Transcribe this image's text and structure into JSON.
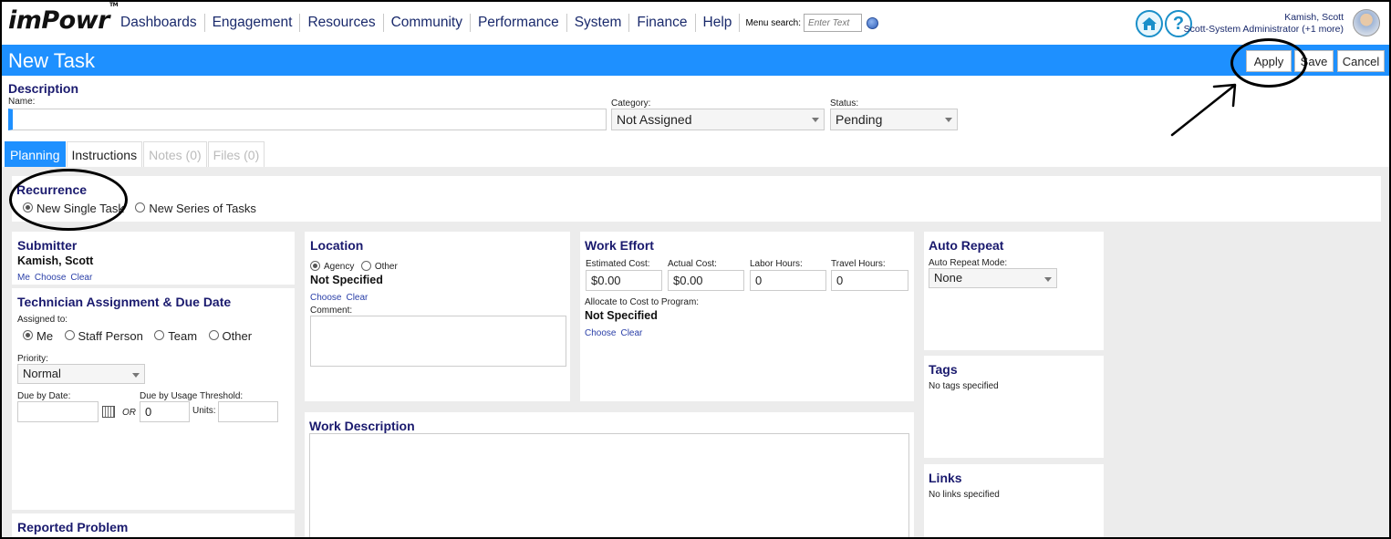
{
  "app": {
    "logo": "imPowr",
    "logo_tm": "TM"
  },
  "nav": {
    "items": [
      "Dashboards",
      "Engagement",
      "Resources",
      "Community",
      "Performance",
      "System",
      "Finance",
      "Help"
    ],
    "menu_search_label": "Menu search:",
    "menu_search_placeholder": "Enter Text"
  },
  "user": {
    "name": "Kamish, Scott",
    "role": "Scott-System Administrator (+1 more)"
  },
  "title_bar": {
    "title": "New Task",
    "apply": "Apply",
    "save": "Save",
    "cancel": "Cancel"
  },
  "description": {
    "title": "Description",
    "name_label": "Name:",
    "name_value": "",
    "category_label": "Category:",
    "category_value": "Not Assigned",
    "status_label": "Status:",
    "status_value": "Pending"
  },
  "tabs": [
    "Planning",
    "Instructions",
    "Notes (0)",
    "Files (0)"
  ],
  "recurrence": {
    "title": "Recurrence",
    "options": [
      "New Single Task",
      "New Series of Tasks"
    ],
    "selected": "New Single Task"
  },
  "submitter": {
    "title": "Submitter",
    "name": "Kamish, Scott",
    "links": [
      "Me",
      "Choose",
      "Clear"
    ]
  },
  "technician": {
    "title": "Technician Assignment & Due Date",
    "assigned_label": "Assigned to:",
    "assigned_options": [
      "Me",
      "Staff Person",
      "Team",
      "Other"
    ],
    "priority_label": "Priority:",
    "priority_value": "Normal",
    "due_date_label": "Due by Date:",
    "or_label": "OR",
    "due_usage_label": "Due by Usage Threshold:",
    "due_usage_value": "0",
    "units_label": "Units:"
  },
  "reported_problem": {
    "title": "Reported Problem"
  },
  "location": {
    "title": "Location",
    "options": [
      "Agency",
      "Other"
    ],
    "value": "Not Specified",
    "links": [
      "Choose",
      "Clear"
    ],
    "comment_label": "Comment:"
  },
  "work_effort": {
    "title": "Work Effort",
    "estimated_cost_label": "Estimated Cost:",
    "estimated_cost": "$0.00",
    "actual_cost_label": "Actual Cost:",
    "actual_cost": "$0.00",
    "labor_hours_label": "Labor Hours:",
    "labor_hours": "0",
    "travel_hours_label": "Travel Hours:",
    "travel_hours": "0",
    "allocate_label": "Allocate to Cost to Program:",
    "allocate_value": "Not Specified",
    "links": [
      "Choose",
      "Clear"
    ]
  },
  "work_description": {
    "title": "Work Description"
  },
  "auto_repeat": {
    "title": "Auto Repeat",
    "mode_label": "Auto Repeat Mode:",
    "mode_value": "None"
  },
  "tags": {
    "title": "Tags",
    "empty": "No tags specified"
  },
  "links_panel": {
    "title": "Links",
    "empty": "No links specified"
  }
}
